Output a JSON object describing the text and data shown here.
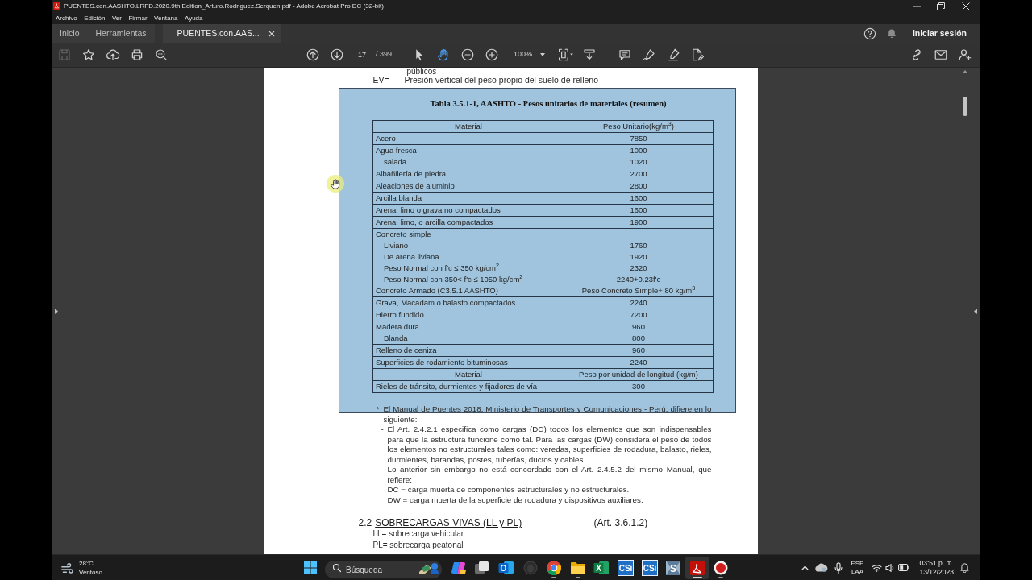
{
  "window": {
    "title": "PUENTES.con.AASHTO.LRFD.2020.9th.Edition_Arturo.Rodriguez.Serquen.pdf - Adobe Acrobat Pro DC (32-bit)"
  },
  "menu": [
    "Archivo",
    "Edición",
    "Ver",
    "Firmar",
    "Ventana",
    "Ayuda"
  ],
  "tabs": [
    {
      "label": "Inicio",
      "selected": false,
      "closable": false
    },
    {
      "label": "Herramientas",
      "selected": false,
      "closable": false
    },
    {
      "label": "PUENTES.con.AAS...",
      "selected": true,
      "closable": true
    }
  ],
  "account": {
    "label": "Iniciar sesión"
  },
  "toolbar": {
    "file_tools": [
      {
        "kind": "save",
        "disabled": true
      },
      {
        "kind": "bookmark",
        "disabled": false
      },
      {
        "kind": "upload",
        "disabled": false
      },
      {
        "kind": "print",
        "disabled": false
      },
      {
        "kind": "find",
        "disabled": false
      }
    ],
    "page_nav": [
      {
        "kind": "prev-page"
      },
      {
        "kind": "next-page"
      }
    ],
    "page": {
      "value": "17",
      "total": "/ 399"
    },
    "modes": [
      {
        "kind": "select",
        "selected": false
      },
      {
        "kind": "hand",
        "selected": true
      }
    ],
    "zoom_buttons": [
      {
        "kind": "zoom-out"
      },
      {
        "kind": "zoom-in"
      }
    ],
    "zoom": {
      "value": "100%"
    },
    "view_tools": [
      {
        "kind": "fit-page"
      },
      {
        "kind": "scroll-mode"
      }
    ],
    "edit_tools": [
      {
        "kind": "comment"
      },
      {
        "kind": "fill-sign"
      },
      {
        "kind": "highlight"
      },
      {
        "kind": "edit-pdf"
      }
    ],
    "share_tools": [
      {
        "kind": "share-link"
      },
      {
        "kind": "email"
      },
      {
        "kind": "add-user"
      }
    ]
  },
  "document": {
    "top_lines": [
      {
        "kind": "fragment",
        "text": "públicos"
      },
      {
        "kind": "definition",
        "term": "EV=",
        "text": "Presión vertical del peso propio del suelo de relleno"
      }
    ],
    "table_panel": {
      "title": "Tabla 3.5.1-1, AASHTO - Pesos unitarios de materiales (resumen)",
      "columns": [
        "Material",
        "Peso Unitario(kg/m$^{3}$)"
      ],
      "rows": [
        {
          "kind": "data",
          "entries": [
            {
              "material": "Acero",
              "value": "7850"
            }
          ]
        },
        {
          "kind": "data",
          "entries": [
            {
              "material": "Agua fresca",
              "value": "1000",
              "children": [
                {
                  "material": "salada",
                  "value": "1020"
                }
              ]
            }
          ]
        },
        {
          "kind": "data",
          "entries": [
            {
              "material": "Albañilería de piedra",
              "value": "2700"
            }
          ]
        },
        {
          "kind": "data",
          "entries": [
            {
              "material": "Aleaciones de aluminio",
              "value": "2800"
            }
          ]
        },
        {
          "kind": "data",
          "entries": [
            {
              "material": "Arcilla blanda",
              "value": "1600"
            }
          ]
        },
        {
          "kind": "data",
          "entries": [
            {
              "material": "Arena, limo o grava no compactados",
              "value": "1600"
            }
          ]
        },
        {
          "kind": "data",
          "entries": [
            {
              "material": "Arena, limo, o arcilla compactados",
              "value": "1900"
            }
          ]
        },
        {
          "kind": "data",
          "entries": [
            {
              "material": "Concreto simple",
              "children": [
                {
                  "material": "Liviano",
                  "value": "1760"
                },
                {
                  "material": "De arena liviana",
                  "value": "1920"
                },
                {
                  "material": "Peso Normal con f'c ≤ 350 kg/cm$^{2}$",
                  "value": "2320"
                },
                {
                  "material": "Peso Normal con 350< f'c ≤ 1050 kg/cm$^{2}$",
                  "value": "2240+0.23f'c"
                }
              ]
            },
            {
              "material": "Concreto Armado (C3.5.1 AASHTO)",
              "value": "Peso Concreto Simple+ 80 kg/m$^{3}$"
            }
          ]
        },
        {
          "kind": "data",
          "entries": [
            {
              "material": "Grava, Macadam o balasto compactados",
              "value": "2240"
            }
          ]
        },
        {
          "kind": "data",
          "entries": [
            {
              "material": "Hierro fundido",
              "value": "7200"
            }
          ]
        },
        {
          "kind": "data",
          "entries": [
            {
              "material": "Madera dura",
              "value": "960",
              "children": [
                {
                  "material": "Blanda",
                  "value": "800"
                }
              ]
            }
          ]
        },
        {
          "kind": "data",
          "entries": [
            {
              "material": "Relleno de ceniza",
              "value": "960"
            }
          ]
        },
        {
          "kind": "data",
          "entries": [
            {
              "material": "Superficies de rodamiento bituminosas",
              "value": "2240"
            }
          ]
        },
        {
          "kind": "subheader",
          "cells": [
            "Material",
            "Peso por unidad de longitud (kg/m)"
          ]
        },
        {
          "kind": "data",
          "entries": [
            {
              "material": "Rieles de tránsito, durmientes y fijadores de vía",
              "value": "300"
            }
          ]
        }
      ]
    },
    "notes": [
      {
        "kind": "footnote",
        "marker": "*",
        "text": "El Manual de Puentes 2018, Ministerio de Transportes y Comunicaciones - Perú, difiere en lo siguiente:"
      },
      {
        "kind": "dash",
        "marker": "-",
        "text": "El Art. 2.4.2.1 especifica como cargas (DC) todos los elementos que son indispensables para que la estructura funcione como tal. Para las cargas (DW) considera el peso de todos los elementos no estructurales tales como: veredas, superficies de rodadura, balasto, rieles, durmientes, barandas, postes, tuberías, ductos y cables."
      },
      {
        "kind": "plain",
        "text": "Lo anterior sin embargo no está concordado con el Art. 2.4.5.2 del mismo Manual, que refiere:"
      },
      {
        "kind": "plain",
        "text": "DC = carga muerta de componentes estructurales y no estructurales."
      },
      {
        "kind": "plain",
        "text": "DW = carga muerta de la superficie de rodadura y dispositivos auxiliares."
      }
    ],
    "section": {
      "number": "2.2",
      "title": "SOBRECARGAS VIVAS (LL y PL)",
      "reference": "(Art. 3.6.1.2)"
    },
    "definitions": [
      "LL= sobrecarga vehicular",
      "PL= sobrecarga peatonal"
    ]
  },
  "taskbar": {
    "weather": {
      "temperature": "28°C",
      "condition": "Ventoso"
    },
    "search": {
      "placeholder": "Búsqueda"
    },
    "apps": [
      {
        "kind": "copilot",
        "running": false,
        "active": false
      },
      {
        "kind": "task-view",
        "running": false,
        "active": false
      },
      {
        "kind": "outlook",
        "glyph": "O",
        "running": false,
        "active": false
      },
      {
        "kind": "dark-app",
        "running": false,
        "active": false
      },
      {
        "kind": "chrome",
        "running": true,
        "active": false
      },
      {
        "kind": "folder",
        "running": true,
        "active": false
      },
      {
        "kind": "excel",
        "glyph": "X",
        "running": false,
        "active": false
      },
      {
        "kind": "csi",
        "glyph": "CSi",
        "running": false,
        "active": false
      },
      {
        "kind": "csi",
        "glyph": "CSi",
        "running": false,
        "active": false
      },
      {
        "kind": "safe",
        "glyph": "S",
        "running": false,
        "active": false
      },
      {
        "kind": "acrobat",
        "running": true,
        "active": true
      },
      {
        "kind": "record",
        "running": true,
        "active": false
      }
    ],
    "tray": {
      "language": "ESP",
      "layout": "LAA",
      "time": "03:51 p. m.",
      "date": "13/12/2023"
    }
  }
}
